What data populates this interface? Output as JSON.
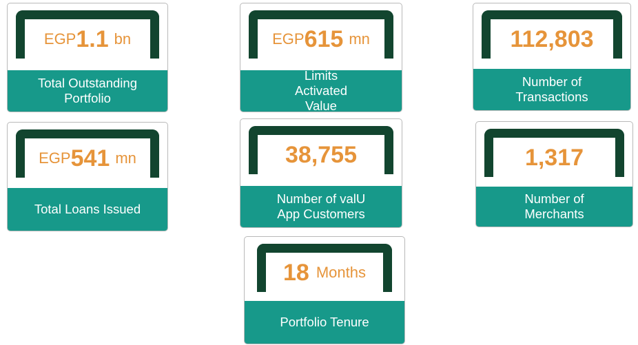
{
  "colors": {
    "accent_orange": "#e6943a",
    "teal": "#17998a",
    "bracket_green": "#12452f",
    "border_gray": "#b9b9b9"
  },
  "cards": {
    "outstanding": {
      "prefix": "EGP",
      "value": "1.1",
      "unit": "bn",
      "label": "Total Outstanding Portfolio"
    },
    "limits": {
      "prefix": "EGP",
      "value": "615",
      "unit": "mn",
      "label": "Limits Activated Value"
    },
    "transactions": {
      "value": "112,803",
      "label_line1": "Number of",
      "label_line2": "Transactions"
    },
    "loans": {
      "prefix": "EGP",
      "value": "541",
      "unit": "mn",
      "label": "Total Loans Issued"
    },
    "customers": {
      "value": "38,755",
      "label_line1": "Number of valU",
      "label_line2": "App Customers"
    },
    "merchants": {
      "value": "1,317",
      "label_line1": "Number of",
      "label_line2": "Merchants"
    },
    "tenure": {
      "value": "18",
      "unit": "Months",
      "label": "Portfolio Tenure"
    }
  }
}
